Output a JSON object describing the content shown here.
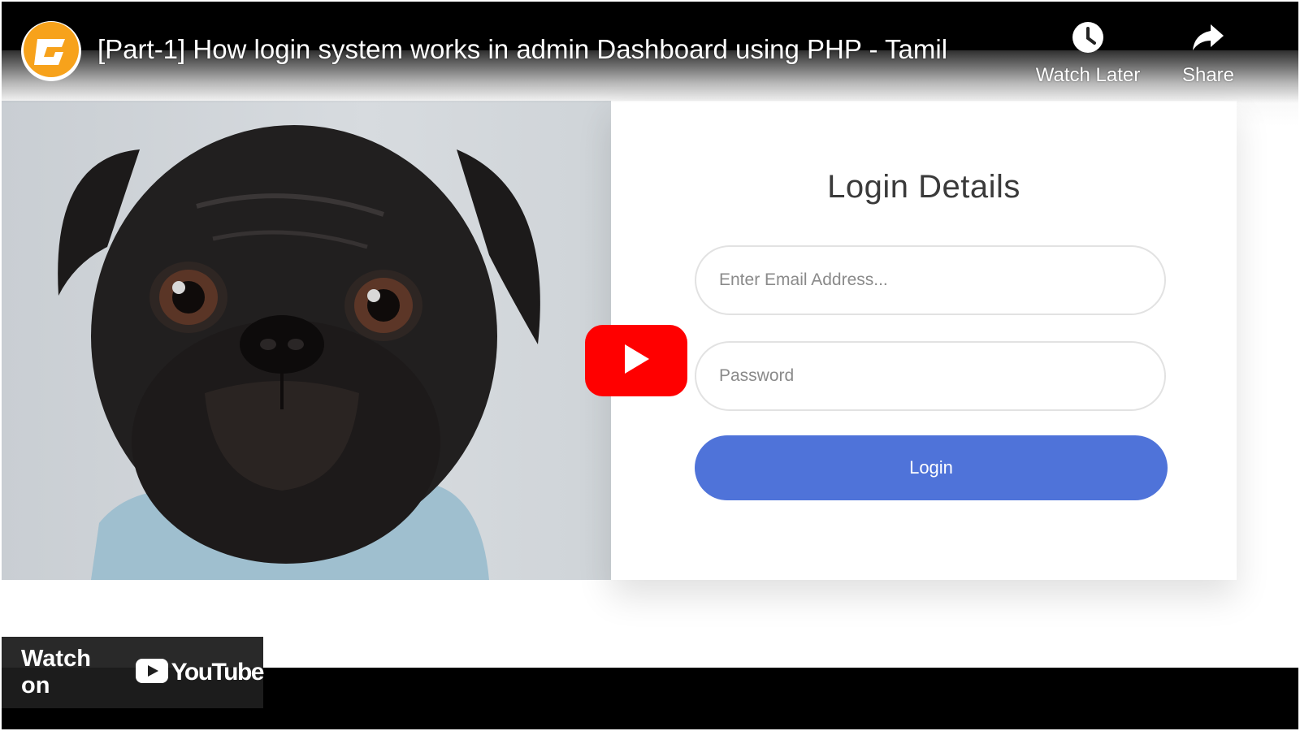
{
  "video": {
    "title": "[Part-1] How login system works in admin Dashboard using PHP - Tamil",
    "channel_icon": "channel-logo-icon"
  },
  "actions": {
    "watch_later": {
      "label": "Watch Later",
      "icon": "clock-icon"
    },
    "share": {
      "label": "Share",
      "icon": "share-arrow-icon"
    }
  },
  "login_card": {
    "title": "Login Details",
    "email_placeholder": "Enter Email Address...",
    "password_placeholder": "Password",
    "login_label": "Login"
  },
  "footer": {
    "watch_on": "Watch on",
    "youtube": "YouTube"
  },
  "colors": {
    "accent_button": "#4f73d9",
    "play_red": "#ff0000",
    "channel_orange": "#f7a21b"
  }
}
